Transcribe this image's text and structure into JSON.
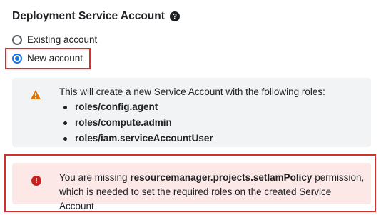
{
  "section": {
    "title": "Deployment Service Account",
    "help_icon": "help-circle-icon"
  },
  "options": {
    "existing_label": "Existing account",
    "new_label": "New account",
    "selected": "New account"
  },
  "info": {
    "icon": "warning-triangle-icon",
    "color": "#e37400",
    "text": "This will create a new Service Account with the following roles:",
    "roles": [
      "roles/config.agent",
      "roles/compute.admin",
      "roles/iam.serviceAccountUser"
    ]
  },
  "error": {
    "icon": "error-circle-icon",
    "color": "#c5221f",
    "text_prefix": "You are missing ",
    "permission": "resourcemanager.projects.setIamPolicy",
    "text_suffix": " permission, which is needed to set the required roles on the created Service Account"
  }
}
